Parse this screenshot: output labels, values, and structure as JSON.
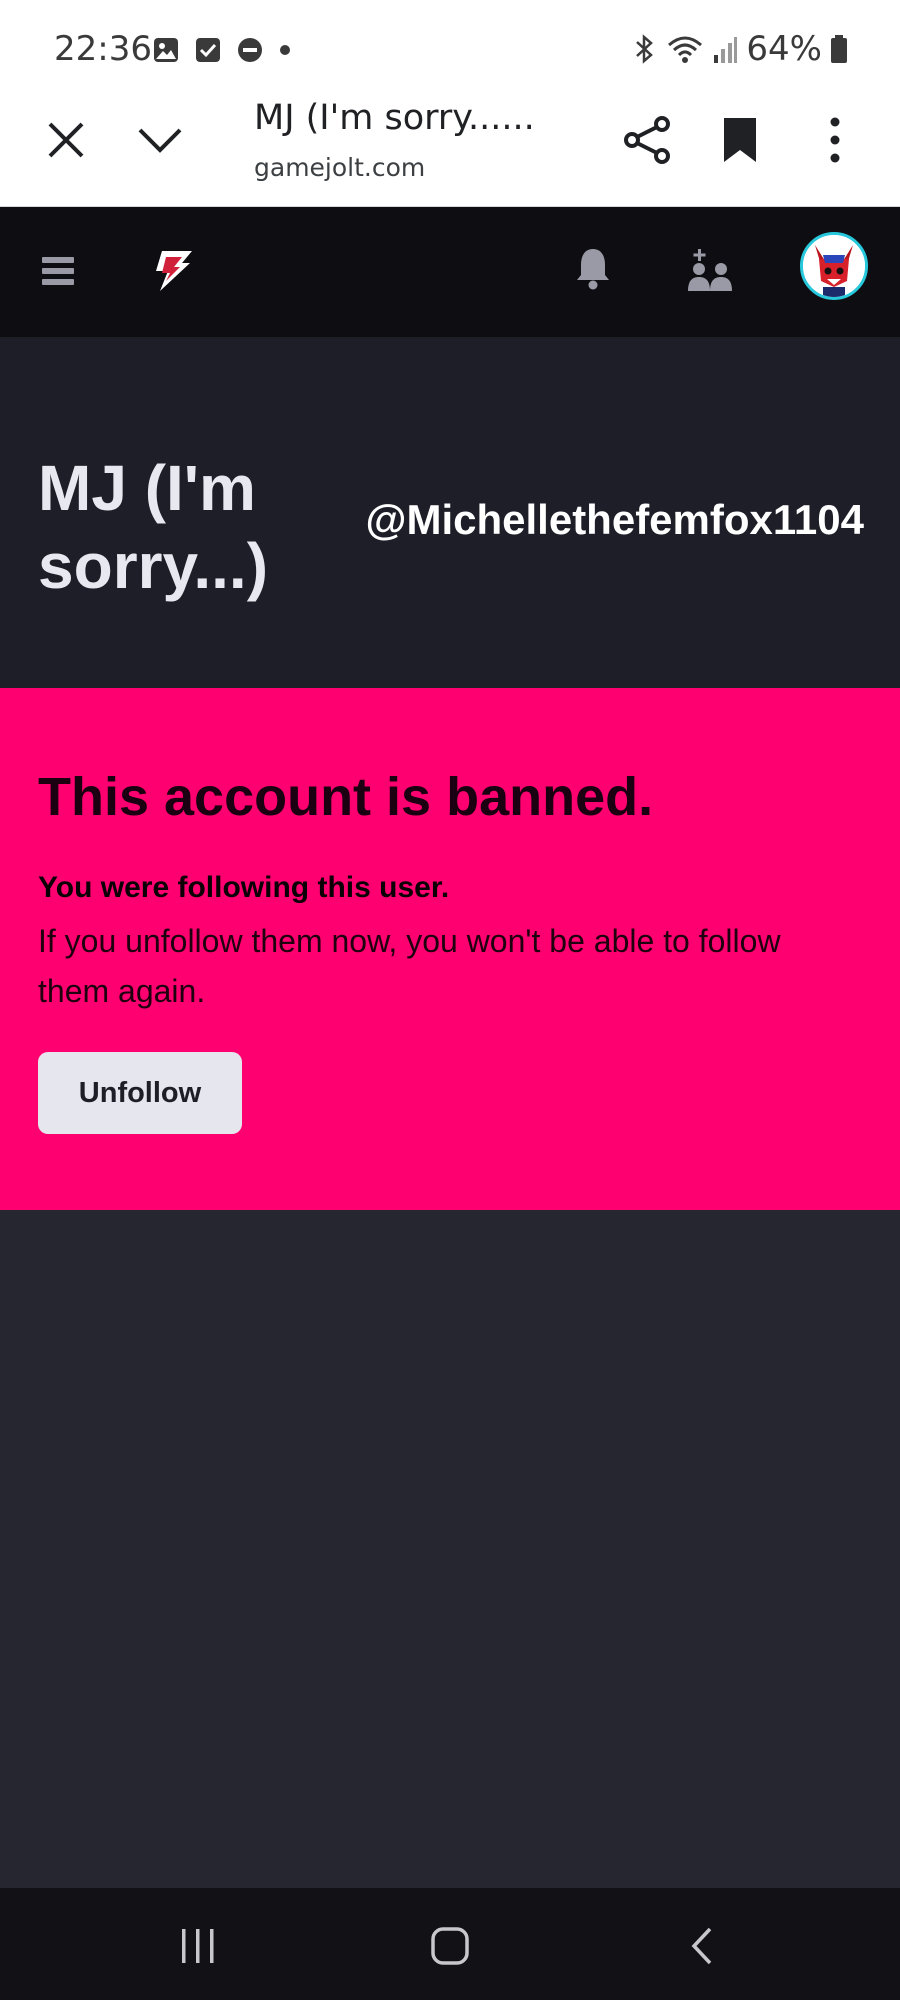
{
  "status_bar": {
    "time": "22:36",
    "battery_percent": "64%",
    "icons": [
      "gallery-icon",
      "checkbox-icon",
      "do-not-disturb-icon",
      "dot-icon",
      "bluetooth-icon",
      "wifi-icon",
      "signal-icon",
      "battery-icon"
    ]
  },
  "browser_tab": {
    "title": "MJ (I'm sorry......",
    "url": "gamejolt.com",
    "icons": [
      "close-icon",
      "chevron-down-icon",
      "share-icon",
      "bookmark-icon",
      "more-vertical-icon"
    ]
  },
  "site_nav": {
    "icons": [
      "menu-icon",
      "gamejolt-logo-icon",
      "bell-icon",
      "friends-icon",
      "avatar"
    ]
  },
  "profile": {
    "display_name": "MJ (I'm sorry...)",
    "username": "@Michellethefemfox1104"
  },
  "banned_notice": {
    "title": "This account is banned.",
    "following_text": "You were following this user.",
    "message": "If you unfollow them now, you won't be able to follow them again.",
    "unfollow_label": "Unfollow"
  },
  "colors": {
    "banned_background": "#ff0071",
    "header_background": "#1e1e28",
    "nav_background": "#0e0e12",
    "page_background": "#262630",
    "avatar_ring": "#28c8dc"
  }
}
